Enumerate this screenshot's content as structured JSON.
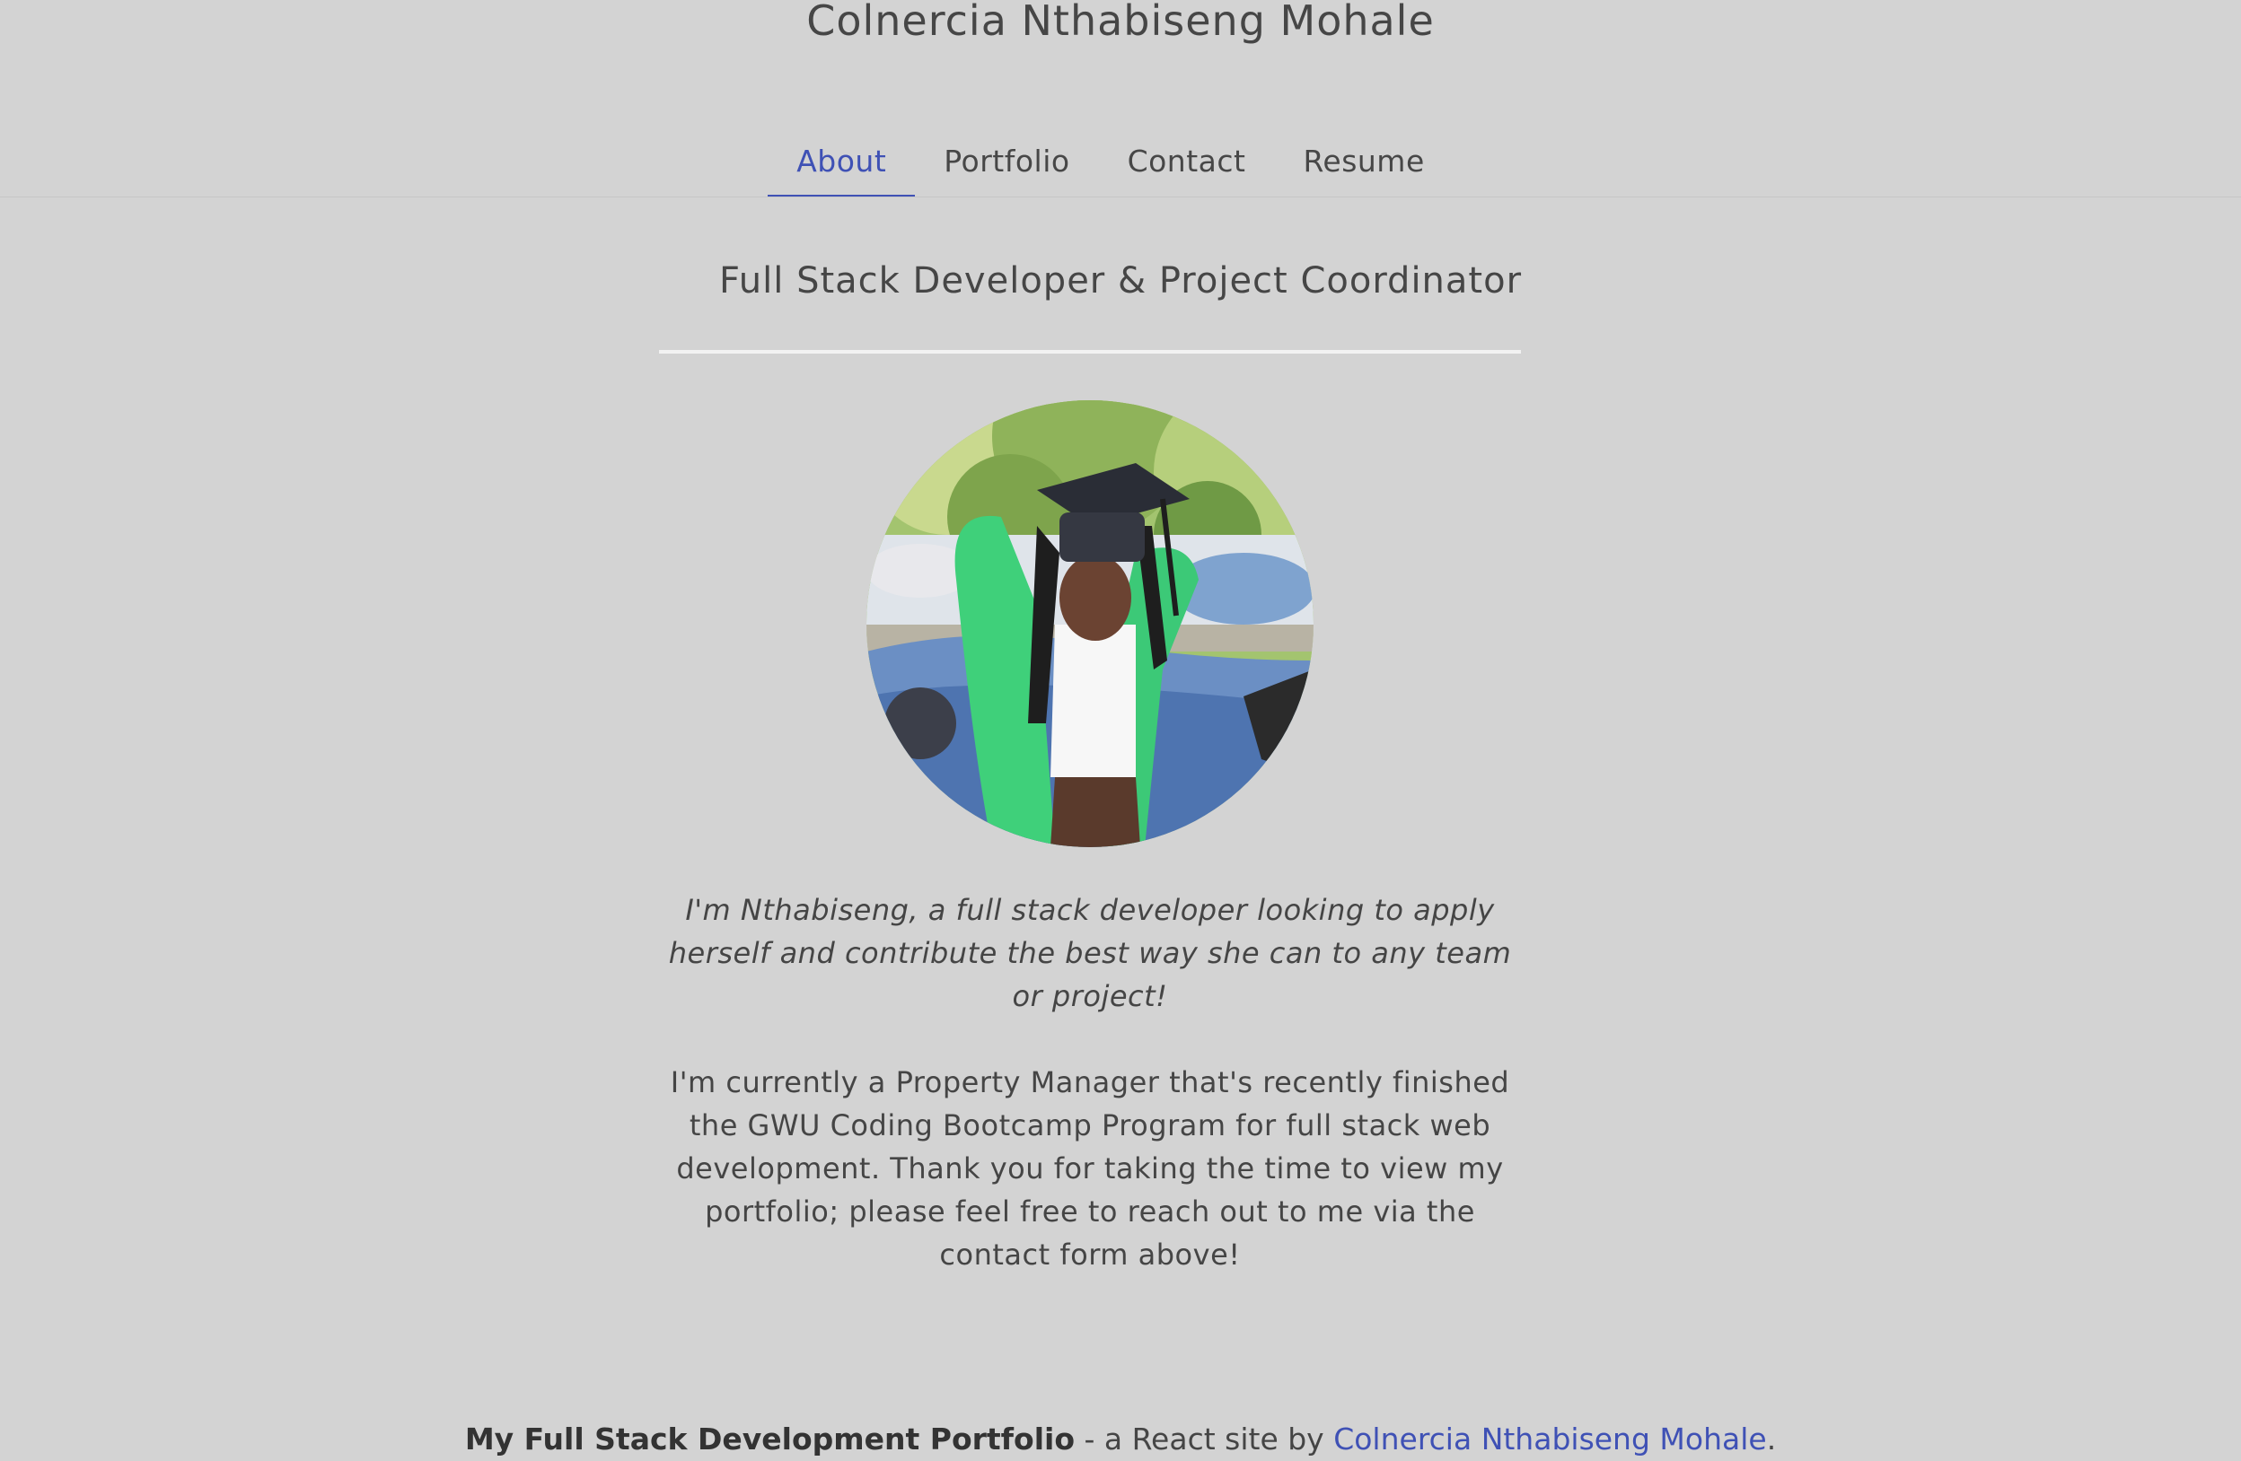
{
  "header": {
    "site_title": "Colnercia Nthabiseng Mohale"
  },
  "nav": {
    "tabs": [
      {
        "label": "About",
        "active": true
      },
      {
        "label": "Portfolio",
        "active": false
      },
      {
        "label": "Contact",
        "active": false
      },
      {
        "label": "Resume",
        "active": false
      }
    ]
  },
  "about": {
    "headline": "Full Stack Developer & Project Coordinator",
    "intro": "I'm Nthabiseng, a full stack developer looking to apply herself and contribute the best way she can to any team or project!",
    "bio": "I'm currently a Property Manager that's recently finished the GWU Coding Bootcamp Program for full stack web development. Thank you for taking the time to view my portfolio; please feel free to reach out to me via the contact form above!"
  },
  "footer": {
    "title": "My Full Stack Development Portfolio",
    "middle": " - a React site by ",
    "author_link": "Colnercia Nthabiseng Mohale",
    "end": "."
  },
  "colors": {
    "background": "#d3d3d3",
    "accent": "#3f51b5",
    "divider": "#f2f2f2"
  }
}
